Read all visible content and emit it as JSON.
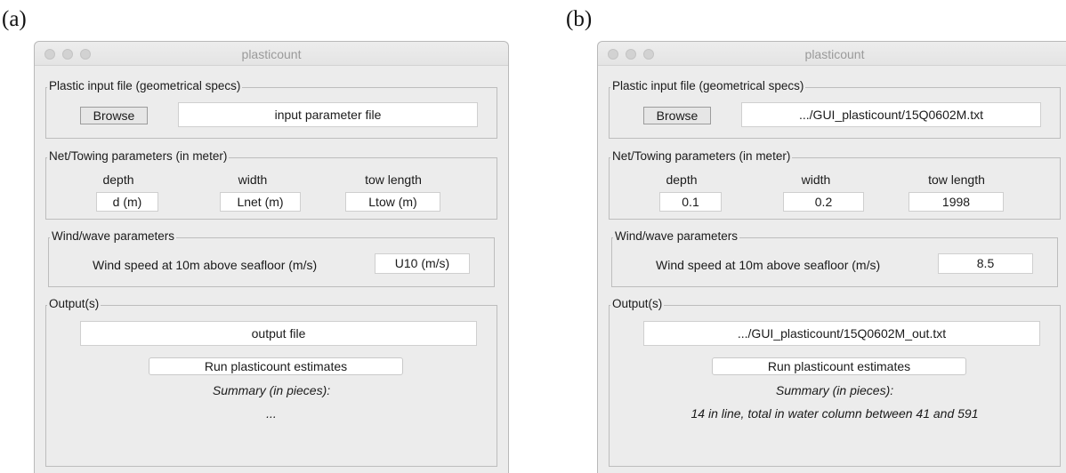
{
  "panels": [
    {
      "label": "(a)",
      "window_title": "plasticount",
      "input_group": {
        "legend": "Plastic input file (geometrical specs)",
        "browse_label": "Browse",
        "file_field": "input parameter file"
      },
      "net_group": {
        "legend": "Net/Towing parameters (in meter)",
        "depth_label": "depth",
        "width_label": "width",
        "tow_length_label": "tow length",
        "depth_value": "d (m)",
        "width_value": "Lnet (m)",
        "tow_length_value": "Ltow (m)"
      },
      "wind_group": {
        "legend": "Wind/wave parameters",
        "label": "Wind speed at 10m above seafloor (m/s)",
        "value": "U10 (m/s)"
      },
      "output_group": {
        "legend": "Output(s)",
        "file_field": "output file",
        "run_label": "Run plasticount estimates",
        "summary_title": "Summary (in pieces):",
        "summary_text": "..."
      }
    },
    {
      "label": "(b)",
      "window_title": "plasticount",
      "input_group": {
        "legend": "Plastic input file (geometrical specs)",
        "browse_label": "Browse",
        "file_field": ".../GUI_plasticount/15Q0602M.txt"
      },
      "net_group": {
        "legend": "Net/Towing parameters (in meter)",
        "depth_label": "depth",
        "width_label": "width",
        "tow_length_label": "tow length",
        "depth_value": "0.1",
        "width_value": "0.2",
        "tow_length_value": "1998"
      },
      "wind_group": {
        "legend": "Wind/wave parameters",
        "label": "Wind speed at 10m above seafloor (m/s)",
        "value": "8.5"
      },
      "output_group": {
        "legend": "Output(s)",
        "file_field": ".../GUI_plasticount/15Q0602M_out.txt",
        "run_label": "Run plasticount estimates",
        "summary_title": "Summary (in pieces):",
        "summary_text": "14 in line, total in water column between 41 and 591"
      }
    }
  ]
}
